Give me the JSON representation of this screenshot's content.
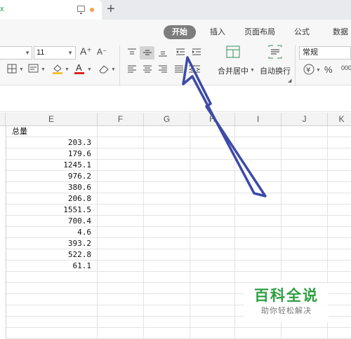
{
  "title_bar": {
    "tab_fragment": "x",
    "new_tab_symbol": "+",
    "modified_dot_color": "#f0a24b"
  },
  "ribbon": {
    "tabs": [
      {
        "label": "开始",
        "active": true
      },
      {
        "label": "插入",
        "active": false
      },
      {
        "label": "页面布局",
        "active": false
      },
      {
        "label": "公式",
        "active": false
      },
      {
        "label": "数据",
        "active": false
      }
    ],
    "font_size": "11",
    "grow_font_label": "A⁺",
    "shrink_font_label": "A⁻",
    "merge_center_label": "合并居中",
    "wrap_text_label": "自动换行",
    "number_format": "常规",
    "currency_symbol": "¥",
    "percent_symbol": "%",
    "comma_label": "000"
  },
  "sheet": {
    "columns": [
      "E",
      "F",
      "G",
      "H",
      "I",
      "J",
      "K"
    ],
    "header_cell": "总量",
    "values": [
      "203.3",
      "179.6",
      "1245.1",
      "976.2",
      "380.6",
      "206.8",
      "1551.5",
      "700.4",
      "4.6",
      "393.2",
      "522.8",
      "61.1"
    ]
  },
  "annotation": {
    "arrow_color": "#3d4aa8",
    "highlight_color": "#7d7d7d"
  },
  "watermark": {
    "title": "百科全说",
    "subtitle": "助你轻松解决",
    "color": "#2e9f42"
  }
}
